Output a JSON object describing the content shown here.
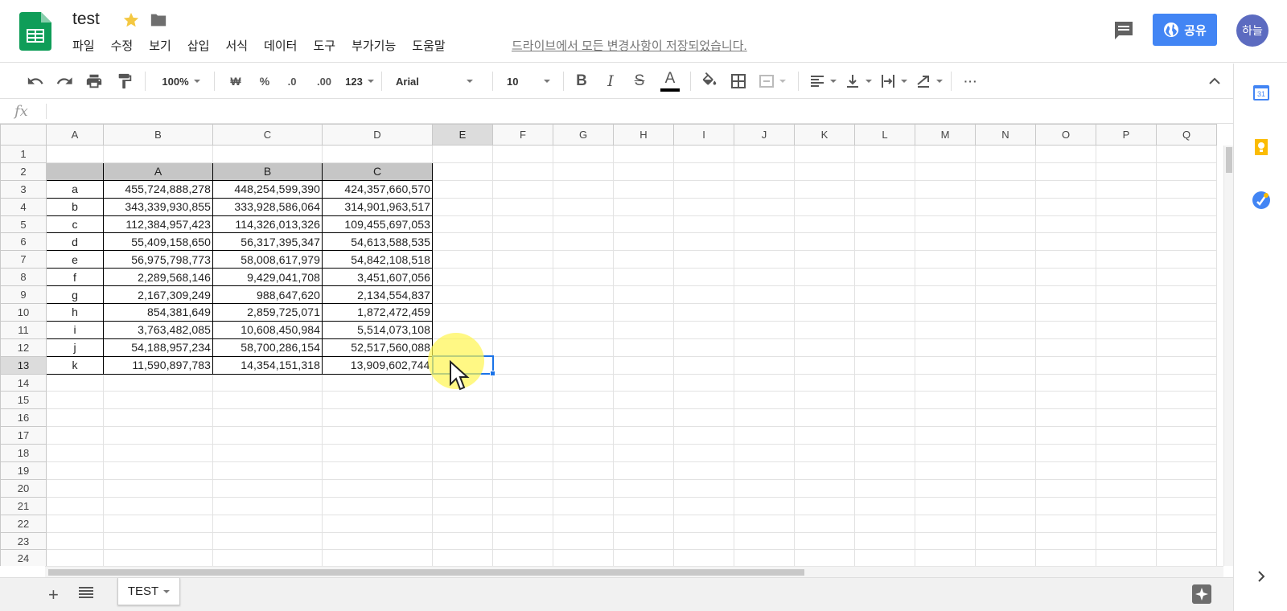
{
  "header": {
    "doc_title": "test",
    "menu": [
      "파일",
      "수정",
      "보기",
      "삽입",
      "서식",
      "데이터",
      "도구",
      "부가기능",
      "도움말"
    ],
    "save_status": "드라이브에서 모든 변경사항이 저장되었습니다.",
    "share_label": "공유",
    "avatar_label": "하늘",
    "colors": {
      "share": "#4285f4",
      "avatar": "#5c6bc0",
      "sheets_green": "#0f9d58"
    }
  },
  "toolbar": {
    "zoom": "100%",
    "currency": "₩",
    "percent": "%",
    "decrease_decimal": ".0",
    "increase_decimal": ".00",
    "number_format": "123",
    "font": "Arial",
    "font_size": "10",
    "bold": "B",
    "italic": "I",
    "strikethrough": "S",
    "text_color": "A",
    "more": "···"
  },
  "formula_bar": {
    "fx": "fx",
    "value": ""
  },
  "grid": {
    "columns": [
      "A",
      "B",
      "C",
      "D",
      "E",
      "F",
      "G",
      "H",
      "I",
      "J",
      "K",
      "L",
      "M",
      "N",
      "O",
      "P",
      "Q"
    ],
    "rows": [
      "1",
      "2",
      "3",
      "4",
      "5",
      "6",
      "7",
      "8",
      "9",
      "10",
      "11",
      "12",
      "13",
      "14",
      "15",
      "16",
      "17",
      "18",
      "19",
      "20",
      "21",
      "22",
      "23",
      "24"
    ],
    "selected_column": "E",
    "selected_row": "13",
    "table_header": [
      "",
      "A",
      "B",
      "C"
    ],
    "table_rows": [
      [
        "a",
        "455,724,888,278",
        "448,254,599,390",
        "424,357,660,570"
      ],
      [
        "b",
        "343,339,930,855",
        "333,928,586,064",
        "314,901,963,517"
      ],
      [
        "c",
        "112,384,957,423",
        "114,326,013,326",
        "109,455,697,053"
      ],
      [
        "d",
        "55,409,158,650",
        "56,317,395,347",
        "54,613,588,535"
      ],
      [
        "e",
        "56,975,798,773",
        "58,008,617,979",
        "54,842,108,518"
      ],
      [
        "f",
        "2,289,568,146",
        "9,429,041,708",
        "3,451,607,056"
      ],
      [
        "g",
        "2,167,309,249",
        "988,647,620",
        "2,134,554,837"
      ],
      [
        "h",
        "854,381,649",
        "2,859,725,071",
        "1,872,472,459"
      ],
      [
        "i",
        "3,763,482,085",
        "10,608,450,984",
        "5,514,073,108"
      ],
      [
        "j",
        "54,188,957,234",
        "58,700,286,154",
        "52,517,560,088"
      ],
      [
        "k",
        "11,590,897,783",
        "14,354,151,318",
        "13,909,602,744"
      ]
    ]
  },
  "sheets": {
    "tabs": [
      "TEST"
    ],
    "add": "+"
  },
  "icons": {
    "logo": "google-sheets-logo",
    "star": "star-icon",
    "folder": "folder-icon",
    "comment": "comment-icon",
    "globe": "globe-icon",
    "calendar": "calendar-icon",
    "keep": "keep-icon",
    "tasks": "tasks-icon"
  },
  "side_panel": {
    "calendar_day": "31"
  }
}
